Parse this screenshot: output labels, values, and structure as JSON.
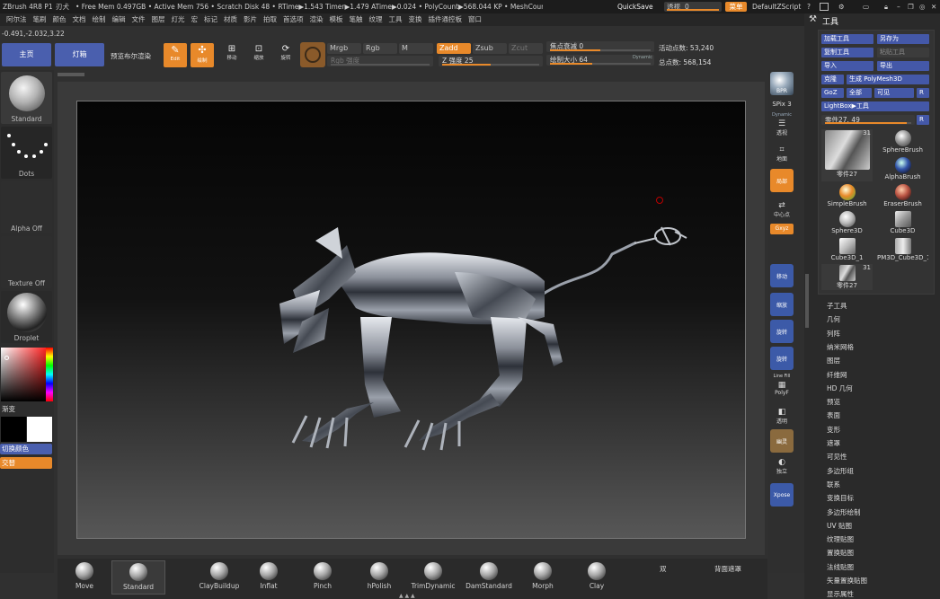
{
  "titlebar": {
    "app": "ZBrush 4R8 P1",
    "doc": "刃犬",
    "stats": "• Free Mem 0.497GB • Active Mem 756 • Scratch Disk 48 • RTime▶1.543 Timer▶1.479 ATime▶0.024 • PolyCount▶568.044 KP • MeshCount▶31",
    "quicksave": "QuickSave",
    "transparency_label": "透视",
    "transparency_value": "0",
    "menu_button": "菜单",
    "script": "DefaultZScript"
  },
  "menubar": [
    "阿尔法",
    "笔刷",
    "颜色",
    "文档",
    "绘制",
    "编辑",
    "文件",
    "图层",
    "灯光",
    "宏",
    "标记",
    "材质",
    "影片",
    "拍取",
    "首选项",
    "渲染",
    "模板",
    "笔触",
    "纹理",
    "工具",
    "变换",
    "插件通控板",
    "窗口"
  ],
  "coords": "-0.491,-2.032,3.22",
  "topshelf": {
    "home": "主页",
    "lightbox": "灯箱",
    "preview_render": "预览布尔渲染",
    "edit": "Edit",
    "draw": "绘制",
    "move": "移动",
    "scale": "缩放",
    "rotate": "旋转",
    "mrgb": "Mrgb",
    "rgb": "Rgb",
    "m": "M",
    "zadd": "Zadd",
    "zsub": "Zsub",
    "zcut": "Zcut",
    "rgb_intensity": "Rgb 强度",
    "z_intensity_label": "Z 强度",
    "z_intensity": "25",
    "focal_label": "焦点衰减",
    "focal": "0",
    "draw_size_label": "绘制大小",
    "draw_size": "64",
    "dynamic": "Dynamic",
    "active_points_label": "活动点数:",
    "active_points": "53,240",
    "total_points_label": "总点数:",
    "total_points": "568,154"
  },
  "leftshelf": {
    "brush": "Standard",
    "stroke": "Dots",
    "alpha": "Alpha Off",
    "texture": "Texture Off",
    "material": "Droplet",
    "gradient": "渐变",
    "switch_color": "切换颜色",
    "alternate": "交替"
  },
  "rightshelf": {
    "bpr": "BPR",
    "spix_label": "SPix",
    "spix": "3",
    "dynamic": "Dynamic",
    "perspective": "透视",
    "floor": "地面",
    "local": "局部",
    "xyz": "Gxyz",
    "frame": "中心点",
    "move": "移动",
    "scale": "缩放",
    "rotate": "旋转",
    "linefill": "Line Fill",
    "polyf": "PolyF",
    "transp": "透明",
    "ghost": "幽灵",
    "solo": "独立",
    "xpose": "Xpose"
  },
  "toolpanel": {
    "title": "工具",
    "load": "加载工具",
    "saveas": "另存为",
    "copy": "复制工具",
    "paste": "粘贴工具",
    "import": "导入",
    "export": "导出",
    "clone": "克隆",
    "make_polymesh": "生成 PolyMesh3D",
    "goz": "GoZ",
    "all": "全部",
    "visible": "可见",
    "r": "R",
    "lightbox_tools": "LightBox▶工具",
    "current_label": "零件27.",
    "current_value": "49",
    "thumbs": [
      {
        "name": "零件27",
        "count": "31"
      },
      {
        "name": "SphereBrush"
      },
      {
        "name": "AlphaBrush"
      },
      {
        "name": "SimpleBrush"
      },
      {
        "name": "EraserBrush"
      },
      {
        "name": "Sphere3D"
      },
      {
        "name": "Cube3D"
      },
      {
        "name": "Cube3D_1"
      },
      {
        "name": "PM3D_Cube3D_1"
      },
      {
        "name": "零件27",
        "count": "31"
      }
    ],
    "menu": [
      "子工具",
      "几何",
      "列阵",
      "纳米网格",
      "图层",
      "纤维网",
      "HD 几何",
      "预览",
      "表面",
      "变形",
      "遮罩",
      "可见性",
      "多边形组",
      "联系",
      "变换目标",
      "多边形绘制",
      "UV 贴图",
      "纹理贴图",
      "置换贴图",
      "法线贴图",
      "矢量置换贴图",
      "显示属性"
    ]
  },
  "bottomshelf": {
    "brushes": [
      "Move",
      "Standard",
      "ClayBuildup",
      "Inflat",
      "Pinch",
      "hPolish",
      "TrimDynamic",
      "DamStandard",
      "Morph",
      "Clay"
    ],
    "double": "双",
    "backface": "背面遮罩"
  },
  "colors": {
    "accent": "#e8892a",
    "blue": "#4a5fae",
    "bg": "#303030"
  }
}
